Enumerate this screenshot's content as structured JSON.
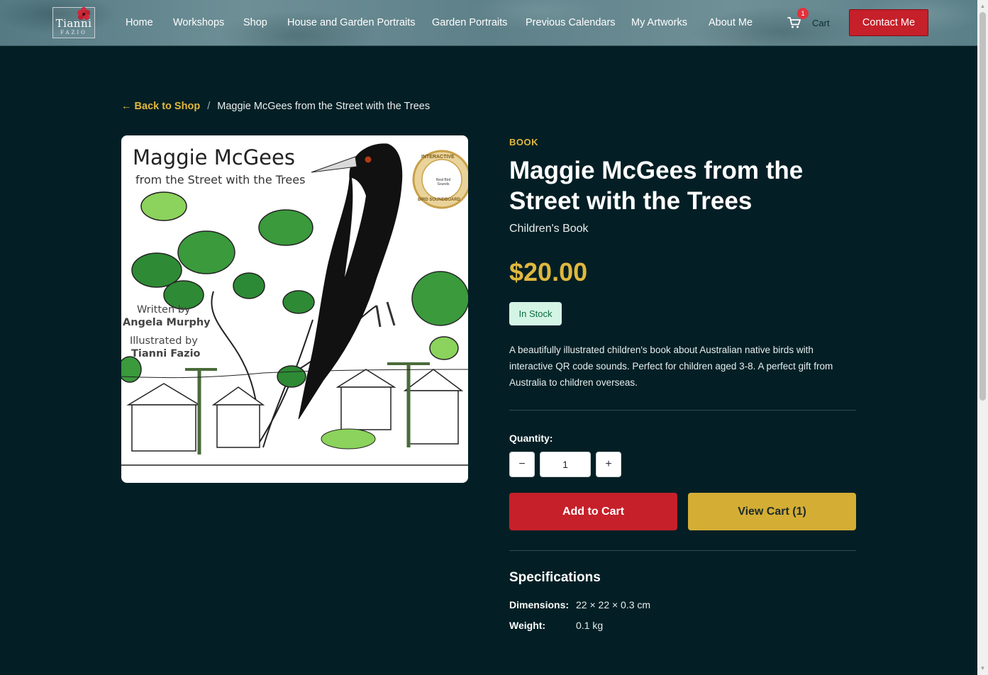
{
  "header": {
    "logo": {
      "name": "Tianni",
      "sub": "FAZIO"
    },
    "nav": [
      "Home",
      "Workshops",
      "Shop",
      "House and Garden Portraits",
      "Garden Portraits",
      "Previous Calendars",
      "My Artworks",
      "About Me"
    ],
    "cart": {
      "label": "Cart",
      "count": "1"
    },
    "contact_label": "Contact Me"
  },
  "breadcrumb": {
    "back": "← Back to Shop",
    "separator": "/",
    "current": "Maggie McGees from the Street with the Trees"
  },
  "product": {
    "image": {
      "title": "Maggie McGees",
      "subtitle": "from the Street with the Trees",
      "written_by": "Written by",
      "author": "Angela Murphy",
      "illustrated_by": "Illustrated by",
      "illustrator": "Tianni Fazio",
      "badge_top": "INTERACTIVE",
      "badge_bottom": "BIRD SOUNDBOARD",
      "badge_center": "Real Bird Sounds"
    },
    "category": "BOOK",
    "title": "Maggie McGees from the Street with the Trees",
    "subtitle": "Children's Book",
    "price": "$20.00",
    "stock": "In Stock",
    "description": "A beautifully illustrated children's book about Australian native birds with interactive QR code sounds. Perfect for children aged 3-8. A perfect gift from Australia to children overseas.",
    "quantity_label": "Quantity:",
    "quantity": "1",
    "minus": "−",
    "plus": "+",
    "add_to_cart": "Add to Cart",
    "view_cart": "View Cart (1)",
    "specs_title": "Specifications",
    "specs": [
      {
        "key": "Dimensions:",
        "value": "22 × 22 × 0.3 cm"
      },
      {
        "key": "Weight:",
        "value": "0.1 kg"
      }
    ]
  },
  "colors": {
    "background": "#031f25",
    "accent_gold": "#e0b83d",
    "accent_red": "#c6202a",
    "stock_green": "#d4f5e6"
  }
}
